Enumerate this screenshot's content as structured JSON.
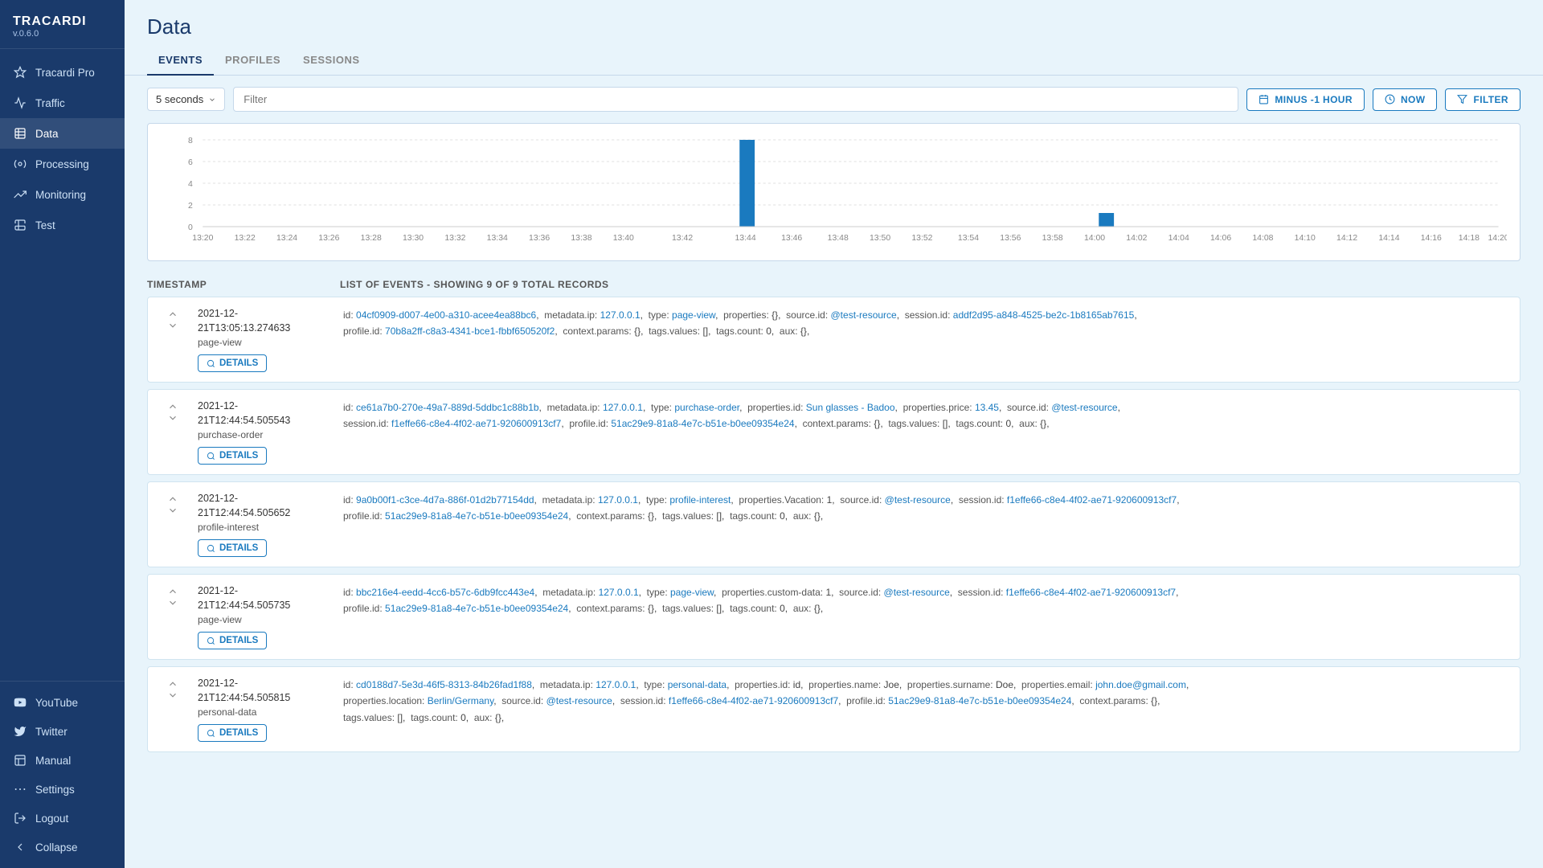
{
  "app": {
    "name": "TRACARDI",
    "version": "v.0.6.0"
  },
  "sidebar": {
    "items": [
      {
        "id": "tracardi-pro",
        "label": "Tracardi Pro",
        "icon": "⭐"
      },
      {
        "id": "traffic",
        "label": "Traffic",
        "icon": "📶"
      },
      {
        "id": "data",
        "label": "Data",
        "icon": "🗄"
      },
      {
        "id": "processing",
        "label": "Processing",
        "icon": "⚙"
      },
      {
        "id": "monitoring",
        "label": "Monitoring",
        "icon": "📊"
      },
      {
        "id": "test",
        "label": "Test",
        "icon": "🧪"
      }
    ],
    "bottom": [
      {
        "id": "youtube",
        "label": "YouTube",
        "icon": "▶"
      },
      {
        "id": "twitter",
        "label": "Twitter",
        "icon": "🐦"
      },
      {
        "id": "manual",
        "label": "Manual",
        "icon": "📋"
      },
      {
        "id": "settings",
        "label": "Settings",
        "icon": "···"
      },
      {
        "id": "logout",
        "label": "Logout",
        "icon": "⏻"
      },
      {
        "id": "collapse",
        "label": "Collapse",
        "icon": "◀"
      }
    ]
  },
  "page": {
    "title": "Data"
  },
  "tabs": [
    {
      "id": "events",
      "label": "EVENTS",
      "active": true
    },
    {
      "id": "profiles",
      "label": "PROFILES",
      "active": false
    },
    {
      "id": "sessions",
      "label": "SESSIONS",
      "active": false
    }
  ],
  "toolbar": {
    "interval": "5 seconds",
    "filter_placeholder": "Filter",
    "minus1hour_label": "MINUS -1 HOUR",
    "now_label": "NOW",
    "filter_label": "FILTER"
  },
  "chart": {
    "y_labels": [
      "8",
      "6",
      "4",
      "2",
      "0"
    ],
    "x_labels": [
      "13:20",
      "13:22",
      "13:24",
      "13:26",
      "13:28",
      "13:30",
      "13:32",
      "13:34",
      "13:36",
      "13:38",
      "13:40",
      "13:42",
      "13:44",
      "13:46",
      "13:48",
      "13:50",
      "13:52",
      "13:54",
      "13:56",
      "13:58",
      "14:00",
      "14:02",
      "14:04",
      "14:06",
      "14:08",
      "14:10",
      "14:12",
      "14:14",
      "14:16",
      "14:18",
      "14:20"
    ],
    "bars": [
      {
        "x": "13:44",
        "value": 8,
        "highlight": true
      },
      {
        "x": "14:05",
        "value": 1,
        "highlight": false
      }
    ]
  },
  "table": {
    "col_timestamp": "TIMESTAMP",
    "col_events": "LIST OF EVENTS - SHOWING 9 OF 9 TOTAL RECORDS"
  },
  "events": [
    {
      "timestamp": "2021-12-21T13:05:13.274633",
      "type": "page-view",
      "id": "04cf0909-d007-4e00-a310-acee4ea88bc6",
      "metadata_ip": "127.0.0.1",
      "event_type": "page-view",
      "properties": "{}",
      "source_id": "@test-resource",
      "session_id": "addf2d95-a848-4525-be2c-1b8165ab7615",
      "profile_id": "70b8a2ff-c8a3-4341-bce1-fbbf650520f2",
      "context_params": "{}",
      "tags_values": "[]",
      "tags_count": "0",
      "aux": "{}"
    },
    {
      "timestamp": "2021-12-21T12:44:54.505543",
      "type": "purchase-order",
      "id": "ce61a7b0-270e-49a7-889d-5ddbc1c88b1b",
      "metadata_ip": "127.0.0.1",
      "event_type": "purchase-order",
      "properties_id": "Sun glasses - Badoo",
      "properties_price": "13.45",
      "source_id": "@test-resource",
      "session_id": "f1effe66-c8e4-4f02-ae71-920600913cf7",
      "profile_id": "51ac29e9-81a8-4e7c-b51e-b0ee09354e24",
      "context_params": "{}",
      "tags_values": "[]",
      "tags_count": "0",
      "aux": "{}"
    },
    {
      "timestamp": "2021-12-21T12:44:54.505652",
      "type": "profile-interest",
      "id": "9a0b00f1-c3ce-4d7a-886f-01d2b77154dd",
      "metadata_ip": "127.0.0.1",
      "event_type": "profile-interest",
      "properties_vacation": "1",
      "source_id": "@test-resource",
      "session_id": "f1effe66-c8e4-4f02-ae71-920600913cf7",
      "profile_id": "51ac29e9-81a8-4e7c-b51e-b0ee09354e24",
      "context_params": "{}",
      "tags_values": "[]",
      "tags_count": "0",
      "aux": "{}"
    },
    {
      "timestamp": "2021-12-21T12:44:54.505735",
      "type": "page-view",
      "id": "bbc216e4-eedd-4cc6-b57c-6db9fcc443e4",
      "metadata_ip": "127.0.0.1",
      "event_type": "page-view",
      "properties_custom_data": "1",
      "source_id": "@test-resource",
      "session_id": "f1effe66-c8e4-4f02-ae71-920600913cf7",
      "profile_id": "51ac29e9-81a8-4e7c-b51e-b0ee09354e24",
      "context_params": "{}",
      "tags_values": "[]",
      "tags_count": "0",
      "aux": "{}"
    },
    {
      "timestamp": "2021-12-21T12:44:54.505815",
      "type": "personal-data",
      "id": "cd0188d7-5e3d-46f5-8313-84b26fad1f88",
      "metadata_ip": "127.0.0.1",
      "event_type": "personal-data",
      "properties_id": "id",
      "properties_name": "Joe",
      "properties_surname": "Doe",
      "properties_email": "john.doe@gmail.com",
      "properties_location": "Berlin/Germany",
      "source_id": "@test-resource",
      "session_id": "f1effe66-c8e4-4f02-ae71-920600913cf7",
      "profile_id": "51ac29e9-81a8-4e7c-b51e-b0ee09354e24",
      "context_params": "{}",
      "tags_values": "[]",
      "tags_count": "0",
      "aux": "{}"
    }
  ]
}
